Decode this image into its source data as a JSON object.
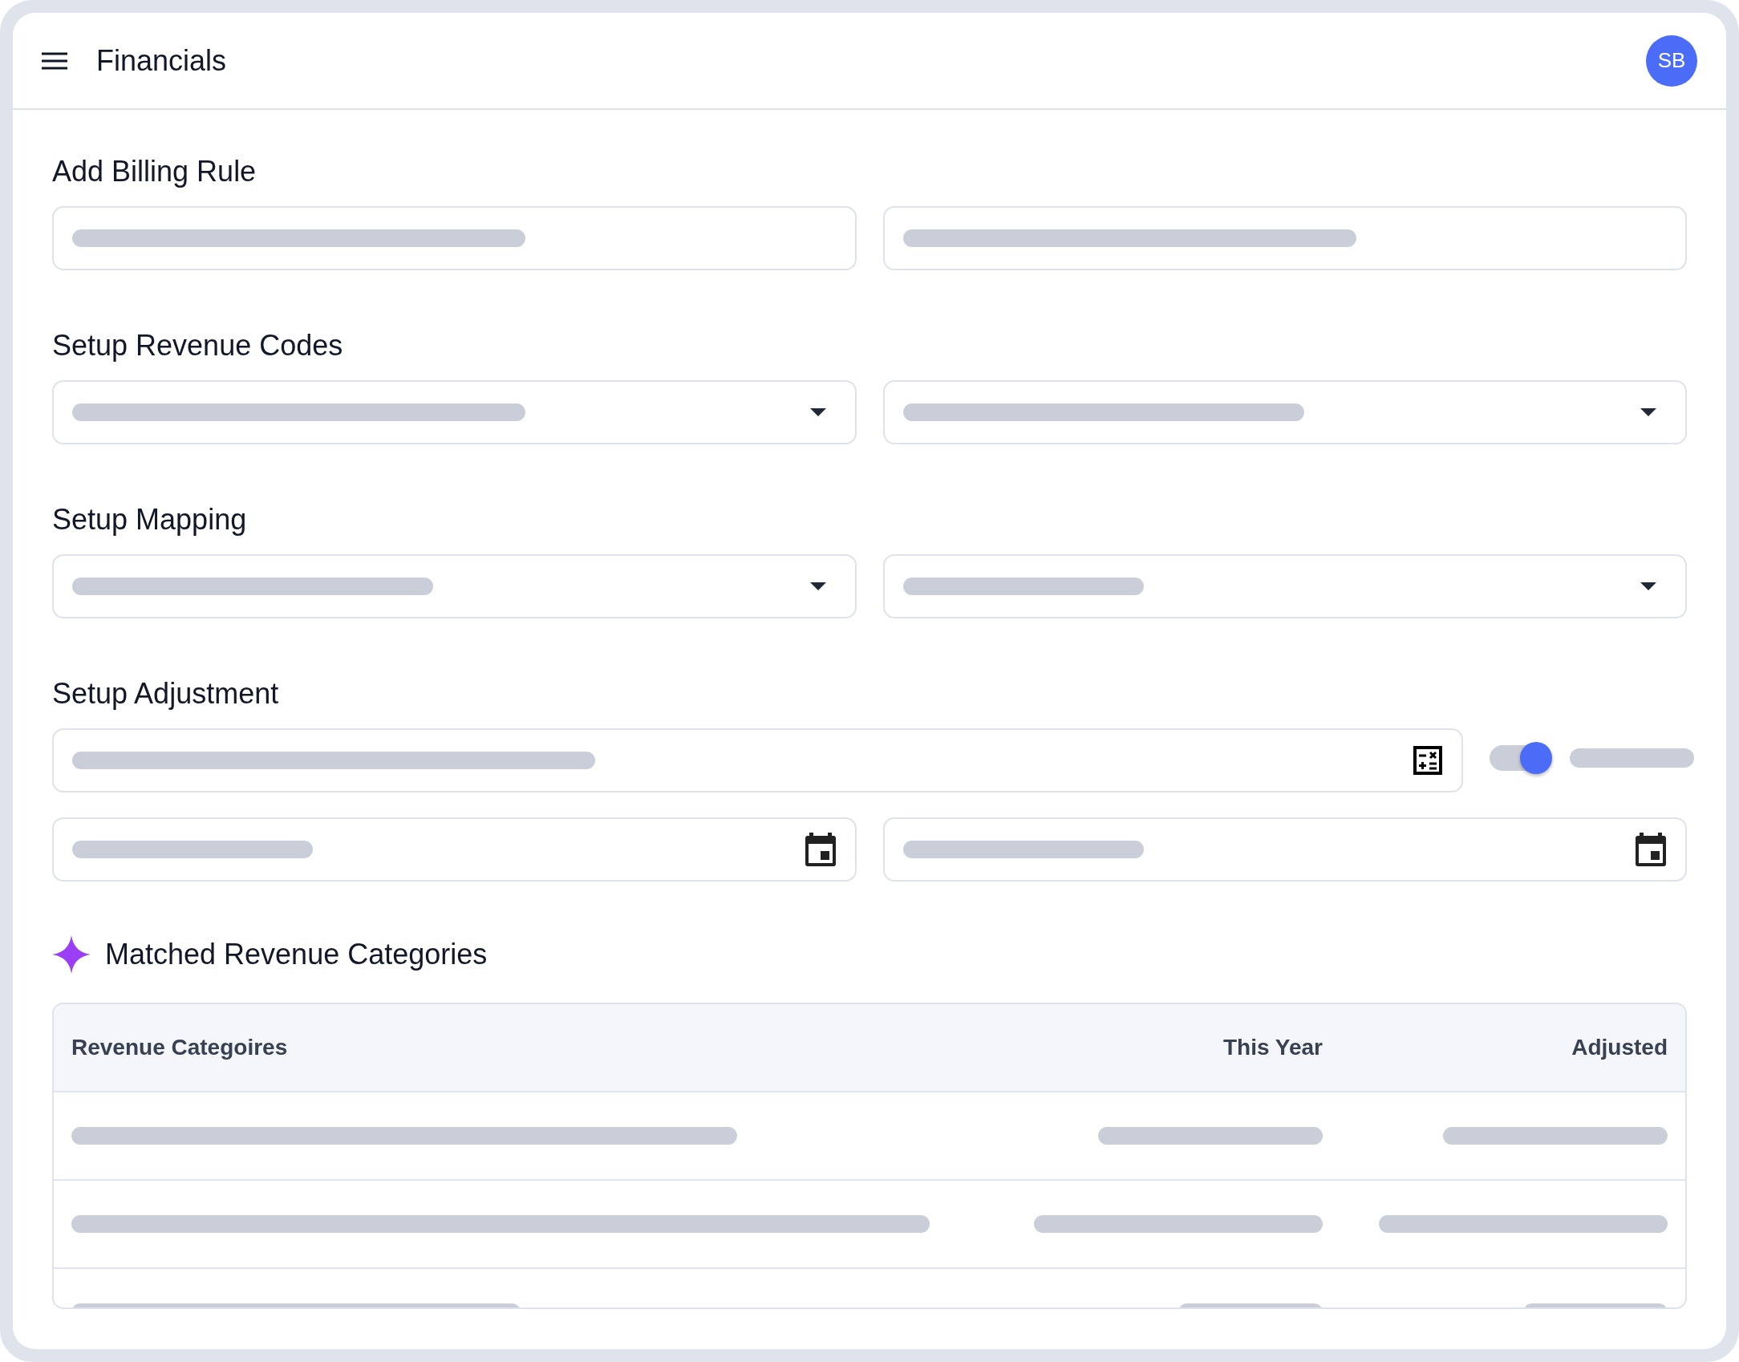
{
  "header": {
    "title": "Financials",
    "avatar": "SB"
  },
  "sections": [
    {
      "title": "Add Billing Rule",
      "rows": [
        [
          {
            "kind": "text"
          },
          {
            "kind": "text"
          }
        ]
      ]
    },
    {
      "title": "Setup Revenue Codes",
      "rows": [
        [
          {
            "kind": "select"
          },
          {
            "kind": "select"
          }
        ]
      ]
    },
    {
      "title": "Setup Mapping",
      "rows": [
        [
          {
            "kind": "select"
          },
          {
            "kind": "select"
          }
        ]
      ]
    },
    {
      "title": "Setup Adjustment",
      "rows": [
        [
          {
            "kind": "calc"
          },
          {
            "kind": "toggle",
            "on": true
          }
        ],
        [
          {
            "kind": "date"
          },
          {
            "kind": "date"
          }
        ]
      ]
    }
  ],
  "matched": {
    "title": "Matched Revenue Categories",
    "columns": [
      "Revenue Categoires",
      "This Year",
      "Adjusted"
    ]
  }
}
